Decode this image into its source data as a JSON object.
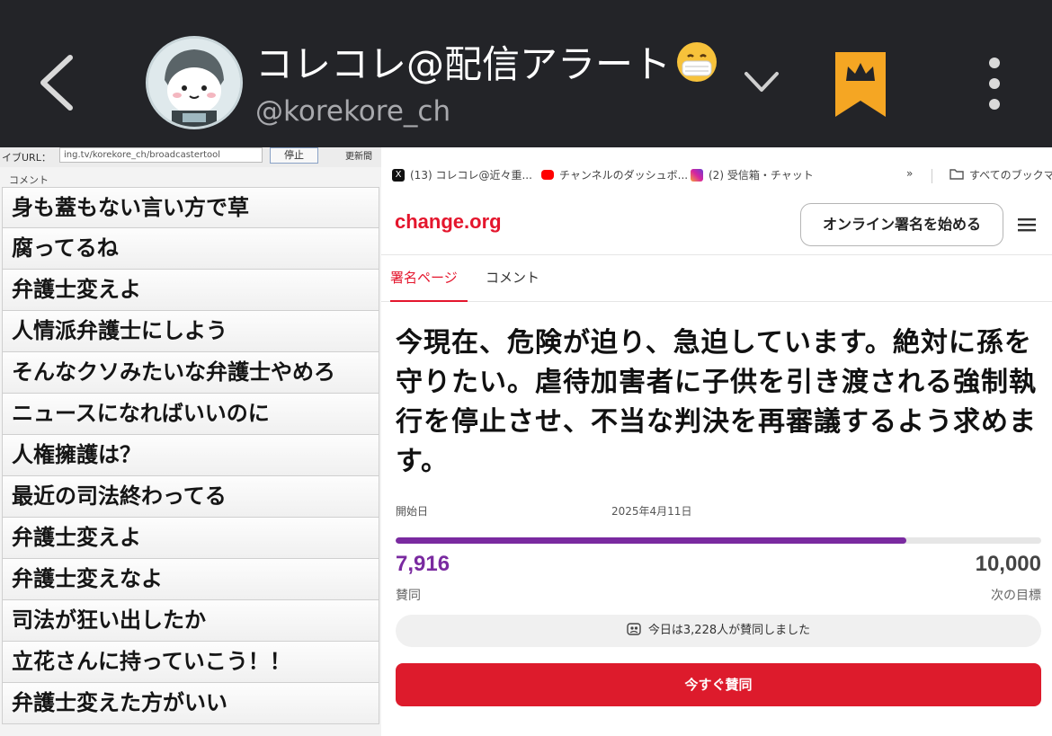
{
  "header": {
    "channel_name": "コレコレ@配信アラート",
    "channel_emoji": "mask-face-emoji",
    "handle": "@korekore_ch",
    "accent_color": "#f5a623"
  },
  "comment_panel": {
    "url_label": "イブURL：",
    "url_value": "ing.tv/korekore_ch/broadcastertool",
    "stop_label": "停止",
    "refresh_label": "更新間",
    "comments_label": "コメント",
    "comments": [
      "身も蓋もない言い方で草",
      "腐ってるね",
      "弁護士変えよ",
      "人情派弁護士にしよう",
      "そんなクソみたいな弁護士やめろ",
      "ニュースになればいいのに",
      "人権擁護は？",
      "最近の司法終わってる",
      "弁護士変えよ",
      "弁護士変えなよ",
      "司法が狂い出したか",
      "立花さんに持っていこう！！",
      "弁護士変えた方がいい"
    ]
  },
  "browser": {
    "bookmarks": [
      {
        "label": "(13) コレコレ@近々重...",
        "icon": "x-icon",
        "color": "#111111"
      },
      {
        "label": "チャンネルのダッシュボ...",
        "icon": "youtube-icon",
        "color": "#ff0000"
      },
      {
        "label": "(2) 受信箱・チャット",
        "icon": "instagram-icon",
        "color": "#d6249f"
      }
    ],
    "overflow": "»",
    "all_bookmarks": "すべてのブックマー",
    "logo": "change.org",
    "start_button": "オンライン署名を始める",
    "tabs": [
      {
        "label": "署名ページ",
        "active": true
      },
      {
        "label": "コメント",
        "active": false
      }
    ],
    "headline": "今現在、危険が迫り、急迫しています。絶対に孫を守りたい。虐待加害者に子供を引き渡される強制執行を停止させ、不当な判決を再審議するよう求めます。",
    "start_label": "開始日",
    "start_date": "2025年4月11日",
    "progress_fraction": 0.7916,
    "signatures": "7,916",
    "signatures_label": "賛同",
    "goal": "10,000",
    "goal_label": "次の目標",
    "today_text": "今日は3,228人が賛同しました",
    "sign_button": "今すぐ賛同",
    "brand_color": "#e4162d",
    "progress_color": "#7a2aa0"
  }
}
